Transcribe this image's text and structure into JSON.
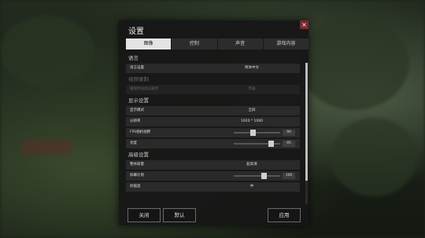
{
  "window": {
    "title": "设置",
    "close_glyph": "×"
  },
  "tabs": [
    {
      "label": "图像",
      "active": true
    },
    {
      "label": "控制",
      "active": false
    },
    {
      "label": "声音",
      "active": false
    },
    {
      "label": "游戏内容",
      "active": false
    }
  ],
  "sections": {
    "language": {
      "title": "语言",
      "rows": [
        {
          "label": "语言设置",
          "value": "简体中文"
        }
      ]
    },
    "video": {
      "title": "视频录制",
      "rows": [
        {
          "label": "播放时间也记录到",
          "value": "普通"
        }
      ]
    },
    "display": {
      "title": "显示设置",
      "rows": [
        {
          "label": "显示模式",
          "value": "全屏"
        },
        {
          "label": "分辨率",
          "value": "1920 * 1080"
        },
        {
          "label": "FPS相机视野",
          "value": "",
          "slider": 0.42,
          "number": "90"
        },
        {
          "label": "亮度",
          "value": "",
          "slider": 0.8,
          "number": "95"
        }
      ]
    },
    "advanced": {
      "title": "高级设置",
      "rows": [
        {
          "label": "整体质量",
          "value": "超高清"
        },
        {
          "label": "屏幕比例",
          "value": "",
          "slider": 0.65,
          "number": "100"
        },
        {
          "label": "抗锯齿",
          "value": "中"
        }
      ]
    }
  },
  "footer": {
    "close_label": "关闭",
    "default_label": "默认",
    "apply_label": "应用"
  },
  "colors": {
    "dialog_bg": "#161616",
    "tab_active": "#e4e4e4",
    "row_bg": "#2a2a2a",
    "slider_thumb": "#cfcfcf"
  }
}
